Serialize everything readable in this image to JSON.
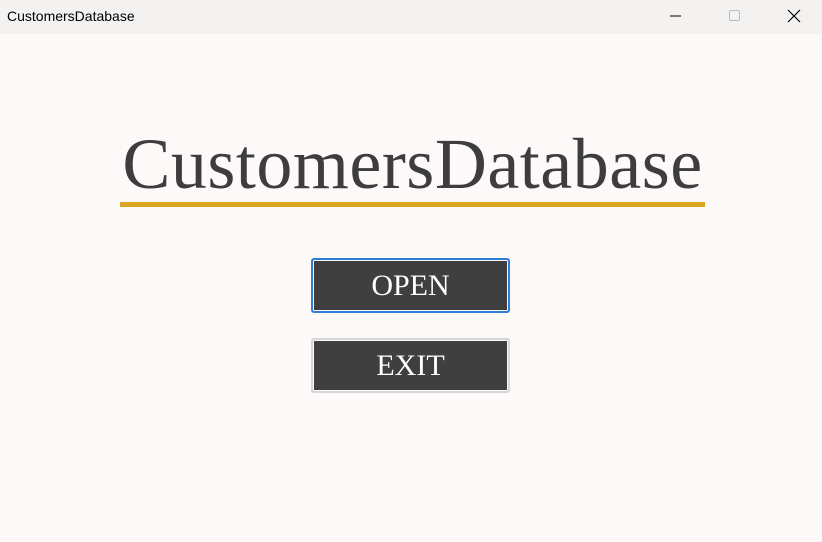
{
  "window": {
    "title": "CustomersDatabase"
  },
  "main": {
    "heading": "CustomersDatabase",
    "accent_color": "#daa520",
    "buttons": {
      "open": "OPEN",
      "exit": "EXIT"
    }
  }
}
